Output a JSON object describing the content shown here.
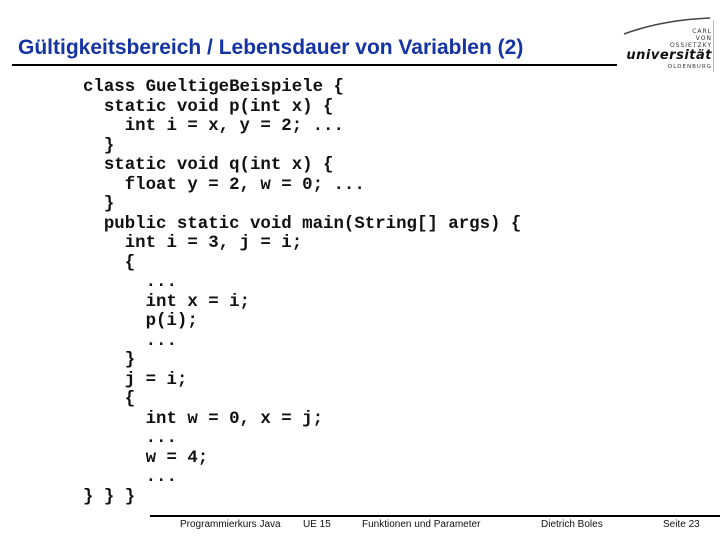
{
  "slide": {
    "title": "Gültigkeitsbereich / Lebensdauer von Variablen (2)"
  },
  "logo": {
    "line1": "CARL",
    "line2": "VON",
    "line3": "OSSIETZKY",
    "line4": "universität",
    "line5": "OLDENBURG"
  },
  "code": {
    "lines": [
      "class GueltigeBeispiele {",
      "  static void p(int x) {",
      "    int i = x, y = 2; ...",
      "  }",
      "  static void q(int x) {",
      "    float y = 2, w = 0; ...",
      "  }",
      "  public static void main(String[] args) {",
      "    int i = 3, j = i;",
      "    {",
      "      ...",
      "      int x = i;",
      "      p(i);",
      "      ...",
      "    }",
      "    j = i;",
      "    {",
      "      int w = 0, x = j;",
      "      ...",
      "      w = 4;",
      "      ...",
      "} } }"
    ]
  },
  "footer": {
    "course": "Programmierkurs Java",
    "unit": "UE 15",
    "topic": "Funktionen und Parameter",
    "author": "Dietrich Boles",
    "page": "Seite 23"
  }
}
